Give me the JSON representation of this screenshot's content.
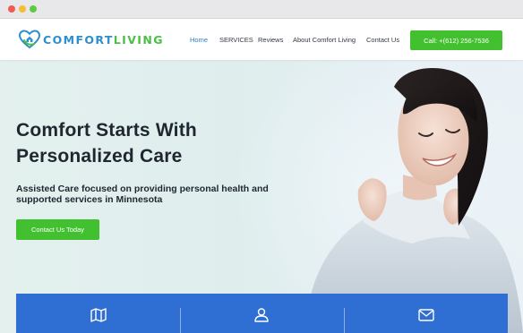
{
  "brand": {
    "name_part1": "COMFORT",
    "name_part2": "LIVING",
    "colors": {
      "blue": "#2c8fd0",
      "green": "#4bbf44"
    }
  },
  "nav": {
    "items": [
      {
        "label": "Home",
        "active": true
      },
      {
        "label": "SERVICES",
        "active": false
      },
      {
        "label": "Reviews",
        "active": false
      },
      {
        "label": "About Comfort Living",
        "active": false
      },
      {
        "label": "Contact Us",
        "active": false
      }
    ],
    "call_button": "Call: +(612) 256-7536"
  },
  "hero": {
    "title": "Comfort Starts With Personalized Care",
    "subtitle": "Assisted Care focused on providing personal health and supported services in Minnesota",
    "cta": "Contact Us Today",
    "image": "smiling-woman-in-knit-sweater"
  },
  "features": {
    "icons": [
      "map-icon",
      "user-icon",
      "mail-icon"
    ],
    "color": "#2f6fd4"
  },
  "accent_green": "#43c02f"
}
